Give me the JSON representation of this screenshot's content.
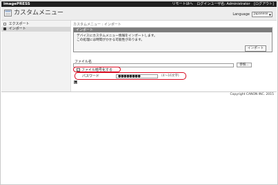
{
  "topbar": {
    "brand": "imagePRESS",
    "links": [
      "リモートUIへ",
      "ログインユーザ名: Administrator",
      "[ログアウト]"
    ]
  },
  "header": {
    "title": "カスタムメニュー",
    "language_label": "Language",
    "language_value": "Japanese"
  },
  "sidebar": {
    "items": [
      {
        "label": "エクスポート",
        "active": false
      },
      {
        "label": "インポート",
        "active": true
      }
    ]
  },
  "main": {
    "breadcrumb": "カスタムメニュー : インポート",
    "panel": {
      "title": "インポート",
      "text_line1": "デバイスにカスタムメニュー情報をインポートします。",
      "text_line2": "この処理には時間がかかる可能性があります。",
      "import_button": "インポート"
    },
    "file_label": "ファイル名",
    "file_value": "",
    "browse_button": "参照...",
    "encrypt_checkbox_label": "ファイル暗号化する",
    "encrypt_checked": true,
    "password_label": "パスワード",
    "password_value": "●●●●●●●●",
    "password_hint": "(4〜16文字)"
  },
  "footer": {
    "copyright": "Copyright CANON INC. 2015"
  },
  "colors": {
    "highlight": "#d8081e",
    "topbar": "#202020",
    "panel_header": "#7c7c7c"
  }
}
